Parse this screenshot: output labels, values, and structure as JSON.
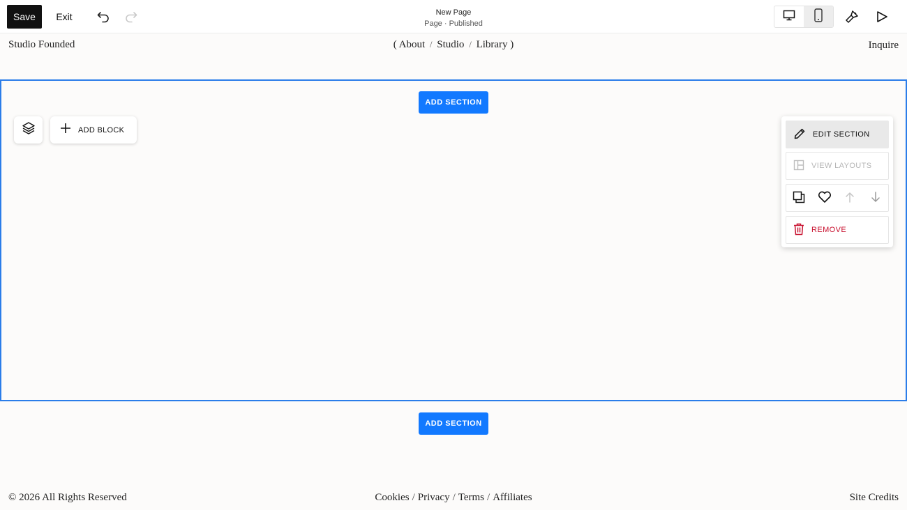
{
  "toolbar": {
    "save_label": "Save",
    "exit_label": "Exit",
    "page_title": "New Page",
    "page_status": "Page · Published",
    "icons": [
      "undo-icon",
      "redo-icon",
      "desktop-icon",
      "mobile-icon",
      "design-brush-icon",
      "preview-play-icon"
    ]
  },
  "site_header": {
    "title": "Studio Founded",
    "nav_open": "(",
    "nav_items": [
      "About",
      "Studio",
      "Library"
    ],
    "nav_sep": "/",
    "nav_close": ")",
    "cta": "Inquire"
  },
  "section": {
    "add_section_label": "ADD SECTION",
    "add_block_label": "ADD BLOCK",
    "accent_color": "#1279ff",
    "selection_color": "#2b7de9"
  },
  "section_menu": {
    "edit_label": "EDIT SECTION",
    "layouts_label": "VIEW LAYOUTS",
    "remove_label": "REMOVE",
    "remove_color": "#c8102e",
    "action_icons": [
      "duplicate-icon",
      "favorite-heart-icon",
      "move-up-icon",
      "move-down-icon"
    ]
  },
  "footer": {
    "copyright": "© 2026 All Rights Reserved",
    "links": [
      "Cookies",
      "Privacy",
      "Terms",
      "Affiliates"
    ],
    "link_sep": "/",
    "credits": "Site Credits"
  }
}
